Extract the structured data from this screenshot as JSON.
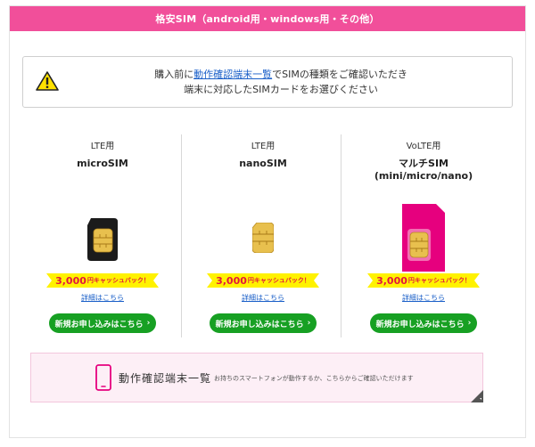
{
  "header": {
    "title": "格安SIM（android用・windows用・その他）"
  },
  "notice": {
    "icon": "warning-icon",
    "line1_before": "購入前に",
    "line1_link": "動作確認端末一覧",
    "line1_after": "でSIMの種類をご確認いただき",
    "line2": "端末に対応したSIMカードをお選びください"
  },
  "products": [
    {
      "label": "LTE用",
      "title": "microSIM",
      "cashback_amount": "3,000",
      "cashback_unit": "円キャッシュバック！",
      "detail_link": "詳細はこちら",
      "apply_label": "新規お申し込みはこちら"
    },
    {
      "label": "LTE用",
      "title": "nanoSIM",
      "cashback_amount": "3,000",
      "cashback_unit": "円キャッシュバック！",
      "detail_link": "詳細はこちら",
      "apply_label": "新規お申し込みはこちら"
    },
    {
      "label": "VoLTE用",
      "title_line1": "マルチSIM",
      "title_line2": "(mini/micro/nano)",
      "cashback_amount": "3,000",
      "cashback_unit": "円キャッシュバック！",
      "detail_link": "詳細はこちら",
      "apply_label": "新規お申し込みはこちら"
    }
  ],
  "device_banner": {
    "icon": "smartphone-icon",
    "title": "動作確認端末一覧",
    "subtitle": "お持ちのスマートフォンが動作するか、こちらからご確認いただけます"
  },
  "colors": {
    "accent_pink": "#f14f9a",
    "button_green": "#17a023",
    "cashback_yellow": "#fff200",
    "cashback_red": "#e2173d",
    "link_blue": "#1a5fc8"
  }
}
